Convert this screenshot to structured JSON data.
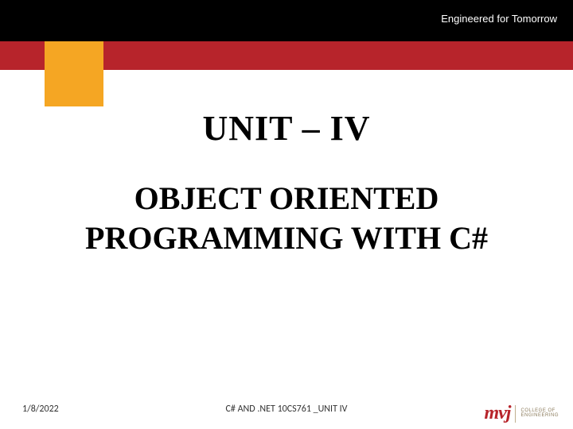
{
  "header": {
    "tagline": "Engineered for Tomorrow"
  },
  "content": {
    "unit_title": "UNIT –  IV",
    "subject_title": "OBJECT ORIENTED PROGRAMMING WITH C#"
  },
  "footer": {
    "date": "1/8/2022",
    "center_text": "C# AND .NET 10CS761 _UNIT IV"
  },
  "logo": {
    "mark": "mvj",
    "line1": "COLLEGE OF",
    "line2": "ENGINEERING"
  }
}
